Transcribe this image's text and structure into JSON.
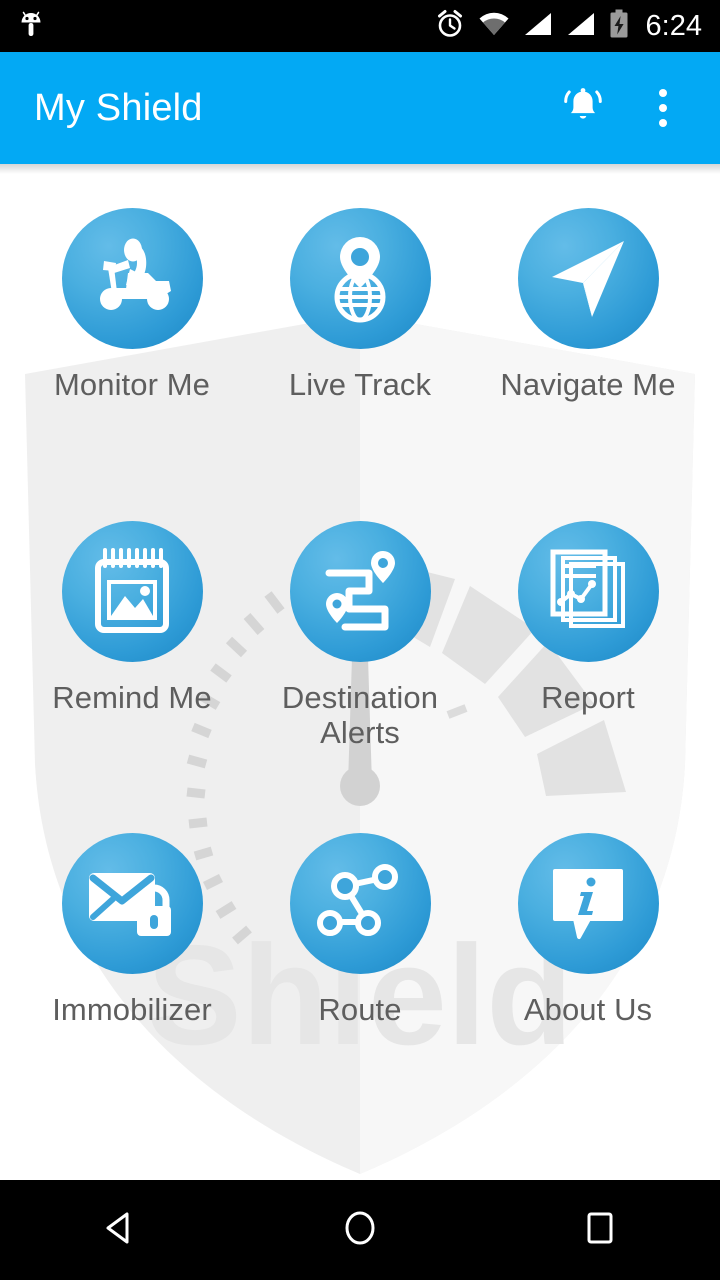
{
  "status_bar": {
    "time": "6:24",
    "icons": [
      {
        "name": "android-head-icon",
        "label": "android"
      },
      {
        "name": "alarm-clock-icon",
        "label": "alarm"
      },
      {
        "name": "wifi-icon",
        "label": "wifi"
      },
      {
        "name": "signal-bars-icon-1",
        "label": "signal 1"
      },
      {
        "name": "signal-bars-icon-2",
        "label": "signal 2"
      },
      {
        "name": "battery-charging-icon",
        "label": "battery charging"
      }
    ]
  },
  "app_bar": {
    "title": "My Shield",
    "notification_icon": "notification-bell-icon",
    "overflow_icon": "overflow-menu-icon",
    "background_color": "#03A9F4",
    "title_color": "#FFFFFF"
  },
  "watermark": {
    "text": "Shield",
    "shape": "shield-with-speedometer",
    "color": "#EDEDED"
  },
  "theme": {
    "icon_gradient_light": "#63BCE8",
    "icon_gradient_dark": "#1B86C4",
    "label_color": "#5E5E5E",
    "page_background": "#FFFFFF"
  },
  "grid": {
    "items": [
      {
        "label": "Monitor Me",
        "icon": "scooter-rider-icon"
      },
      {
        "label": "Live Track",
        "icon": "pin-over-globe-icon"
      },
      {
        "label": "Navigate Me",
        "icon": "navigation-arrow-icon"
      },
      {
        "label": "Remind Me",
        "icon": "notepad-photo-icon"
      },
      {
        "label": "Destination\nAlerts",
        "icon": "route-pins-icon"
      },
      {
        "label": "Report",
        "icon": "documents-chart-icon"
      },
      {
        "label": "Immobilizer",
        "icon": "envelope-lock-icon"
      },
      {
        "label": "Route",
        "icon": "node-graph-icon"
      },
      {
        "label": "About Us",
        "icon": "info-bubble-icon"
      }
    ]
  },
  "nav_bar": {
    "back_label": "Back",
    "home_label": "Home",
    "recents_label": "Recents"
  }
}
